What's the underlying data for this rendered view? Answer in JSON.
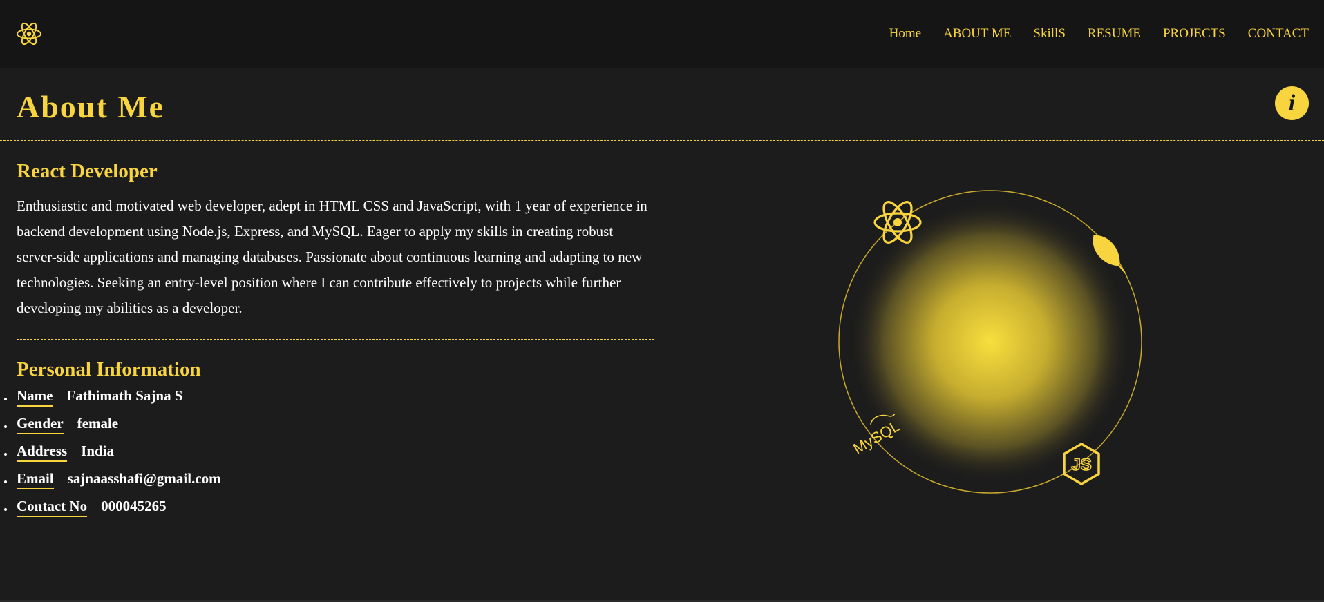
{
  "nav": {
    "logo_icon": "react-atom-icon",
    "links": [
      "Home",
      "ABOUT ME",
      "SkillS",
      "RESUME",
      "PROJECTS",
      "CONTACT"
    ]
  },
  "header": {
    "title": "About Me",
    "info_glyph": "i"
  },
  "about": {
    "role": "React Developer",
    "bio": "Enthusiastic and motivated web developer, adept in HTML CSS and JavaScript, with 1 year of experience in backend development using Node.js, Express, and MySQL. Eager to apply my skills in creating robust server-side applications and managing databases. Passionate about continuous learning and adapting to new technologies. Seeking an entry-level position where I can contribute effectively to projects while further developing my abilities as a developer."
  },
  "personal": {
    "title": "Personal Information",
    "items": [
      {
        "label": "Name",
        "value": "Fathimath Sajna S"
      },
      {
        "label": "Gender",
        "value": "female"
      },
      {
        "label": "Address",
        "value": "India"
      },
      {
        "label": "Email",
        "value": "sajnaasshafi@gmail.com"
      },
      {
        "label": "Contact No",
        "value": "000045265"
      }
    ]
  },
  "orbit": {
    "icons": [
      "react-icon",
      "leaf-icon",
      "nodejs-icon",
      "mysql-icon"
    ],
    "mysql_text": "MySQL",
    "js_text": "JS"
  },
  "colors": {
    "accent": "#f8d53e",
    "background": "#1c1c1c",
    "navbar": "#151515"
  }
}
